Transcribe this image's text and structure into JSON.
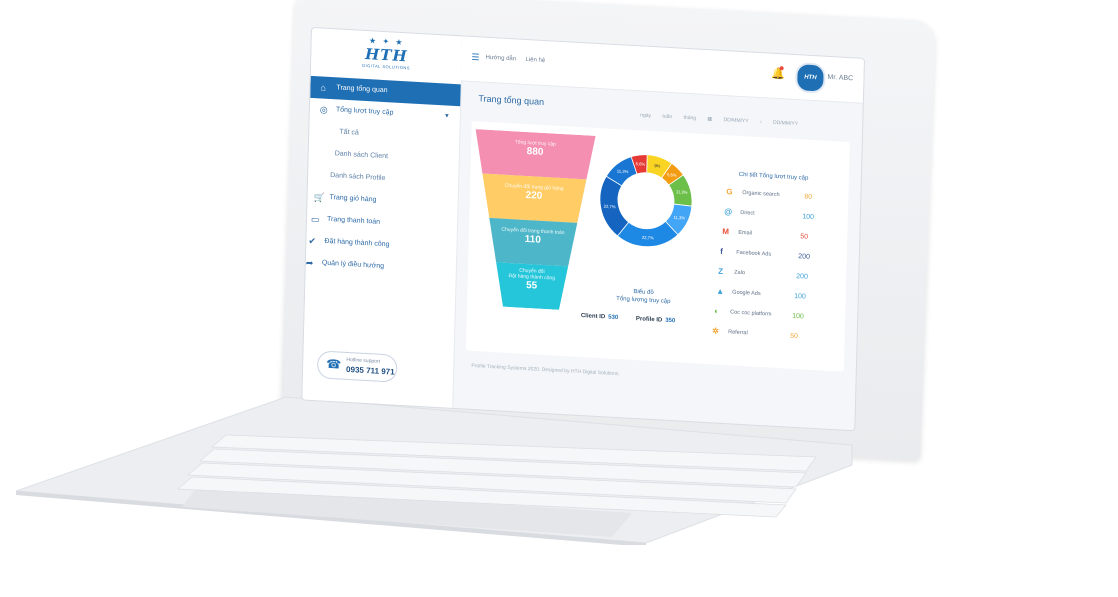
{
  "sidebar": {
    "logo": {
      "mark": "HTH",
      "subtitle": "DIGITAL SOLUTIONS"
    },
    "items": [
      {
        "label": "Trang tổng quan",
        "icon": "home-icon"
      },
      {
        "label": "Tổng lượt truy cập",
        "icon": "location-pin-icon"
      },
      {
        "label": "Tất cả"
      },
      {
        "label": "Danh sách Client"
      },
      {
        "label": "Danh sách Profile"
      },
      {
        "label": "Trang giỏ hàng",
        "icon": "cart-icon"
      },
      {
        "label": "Trang thanh toán",
        "icon": "credit-card-icon"
      },
      {
        "label": "Đặt hàng thành công",
        "icon": "check-circle-icon"
      },
      {
        "label": "Quản lý điều hướng",
        "icon": "share-arrow-icon"
      }
    ],
    "hotline": {
      "label": "Hotline support",
      "number": "0935 711 971"
    }
  },
  "topbar": {
    "links": [
      "Hướng dẫn",
      "Liên hệ"
    ],
    "user": "Mr. ABC",
    "avatar_text": "HTH"
  },
  "main": {
    "title": "Trang tổng quan",
    "filters": [
      "ngày",
      "tuần",
      "tháng",
      "DD/MM/YY",
      "DD/MM/YY"
    ],
    "funnel": [
      {
        "label": "Tổng lượt truy cập",
        "value": "880",
        "color": "#f48fb1"
      },
      {
        "label": "Chuyển đổi trang giỏ hàng",
        "value": "220",
        "color": "#ffcc66"
      },
      {
        "label": "Chuyển đổi trang thanh toán",
        "value": "110",
        "color": "#4db6c9"
      },
      {
        "label": "Chuyển đổi\nĐặt hàng thành công",
        "value": "55",
        "color": "#26c6da"
      }
    ],
    "donut": {
      "title": "Biểu đồ\nTổng lượng truy cập",
      "slices": [
        {
          "label": "9%",
          "value": 9,
          "color": "#f9d423"
        },
        {
          "label": "5,6%",
          "value": 5.6,
          "color": "#f39c12"
        },
        {
          "label": "11,3%",
          "value": 11.3,
          "color": "#6cc04a"
        },
        {
          "label": "11,3%",
          "value": 11.3,
          "color": "#42a5f5"
        },
        {
          "label": "22,7%",
          "value": 22.7,
          "color": "#1e88e5"
        },
        {
          "label": "22,7%",
          "value": 22.7,
          "color": "#1565c0"
        },
        {
          "label": "11,3%",
          "value": 11.3,
          "color": "#1976d2"
        },
        {
          "label": "5,6%",
          "value": 5.6,
          "color": "#e53935"
        }
      ]
    },
    "ids": {
      "client_label": "Client ID",
      "client_value": "530",
      "profile_label": "Profile ID",
      "profile_value": "350"
    },
    "sources_title": "Chi tiết Tổng lượt truy cập",
    "sources": [
      {
        "name": "Organic search",
        "value": "80",
        "icon": "google-icon",
        "color": "#f2a93b"
      },
      {
        "name": "Direct",
        "value": "100",
        "icon": "at-sign-icon",
        "color": "#3aa0d8"
      },
      {
        "name": "Email",
        "value": "50",
        "icon": "gmail-icon",
        "color": "#e8503a"
      },
      {
        "name": "Facebook Ads",
        "value": "200",
        "icon": "facebook-icon",
        "color": "#3b5998"
      },
      {
        "name": "Zalo",
        "value": "200",
        "icon": "zalo-icon",
        "color": "#3aa0d8"
      },
      {
        "name": "Google Ads",
        "value": "100",
        "icon": "google-ads-icon",
        "color": "#3aa0d8"
      },
      {
        "name": "Coc coc platform",
        "value": "100",
        "icon": "coccoc-icon",
        "color": "#6cc04a"
      },
      {
        "name": "Referral",
        "value": "50",
        "icon": "referral-icon",
        "color": "#f2a93b"
      }
    ]
  },
  "footer": "Profile Tracking Systems 2020. Designed by HTH Digital Solutions."
}
